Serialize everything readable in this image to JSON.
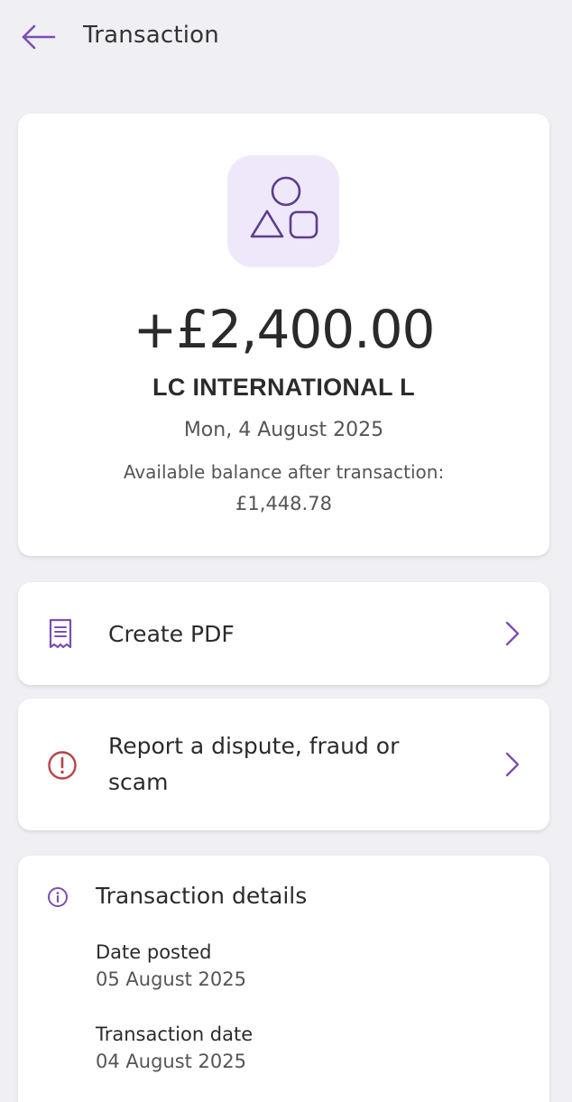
{
  "header": {
    "title": "Transaction",
    "back_icon": "arrow-left-icon"
  },
  "summary": {
    "merchant_icon": "shapes-icon",
    "amount": "+£2,400.00",
    "merchant_name": "LC INTERNATIONAL L",
    "date": "Mon, 4 August 2025",
    "balance_label": "Available balance after transaction:",
    "balance_value": "£1,448.78"
  },
  "actions": [
    {
      "label": "Create PDF",
      "icon": "receipt-icon"
    },
    {
      "label": "Report a dispute, fraud or",
      "label_line2": "scam",
      "icon": "alert-circle-icon"
    }
  ],
  "details": {
    "title": "Transaction details",
    "icon": "info-icon",
    "items": [
      {
        "label": "Date posted",
        "value": "05 August 2025"
      },
      {
        "label": "Transaction date",
        "value": "04 August 2025"
      }
    ]
  },
  "colors": {
    "accent": "#7a4fb5",
    "alert": "#b8434a",
    "background": "#f0eff4",
    "icon_tile": "#efe8fa"
  }
}
